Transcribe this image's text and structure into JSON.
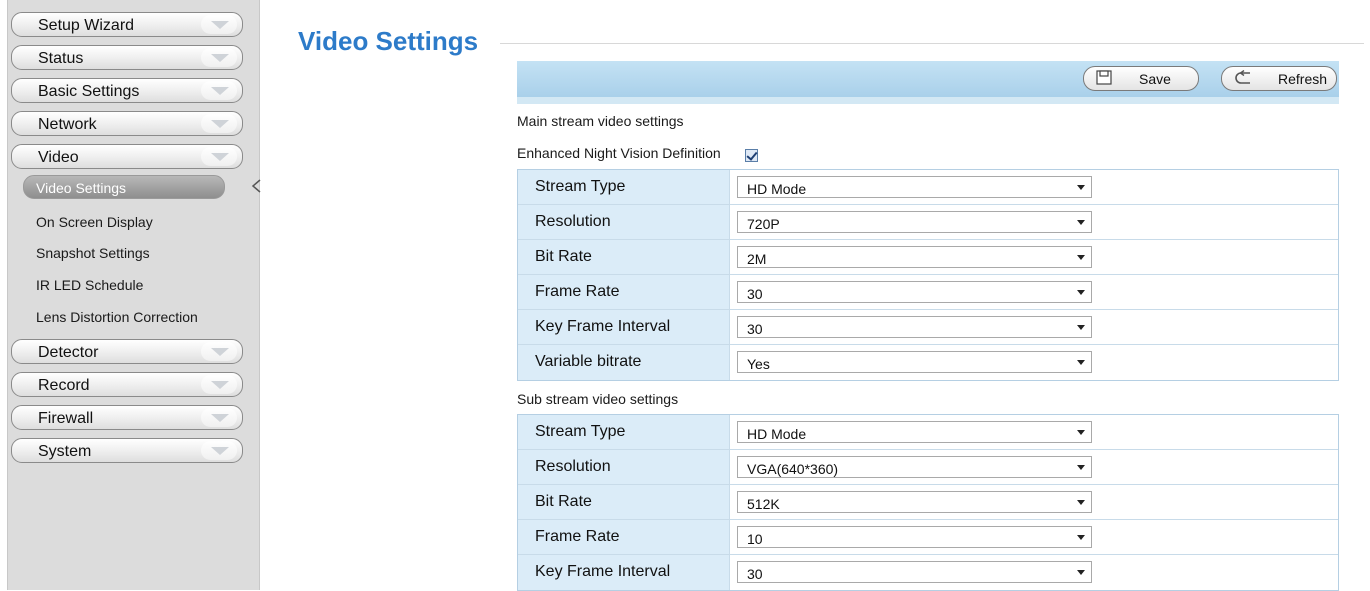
{
  "sidebar": {
    "menus_top": [
      "Setup Wizard",
      "Status",
      "Basic Settings",
      "Network",
      "Video"
    ],
    "video_subitems": [
      "Video Settings",
      "On Screen Display",
      "Snapshot Settings",
      "IR LED Schedule",
      "Lens Distortion Correction"
    ],
    "menus_bottom": [
      "Detector",
      "Record",
      "Firewall",
      "System"
    ]
  },
  "page": {
    "title": "Video Settings"
  },
  "toolbar": {
    "save_label": "Save",
    "refresh_label": "Refresh"
  },
  "main_stream": {
    "section_label": "Main stream video settings",
    "night_vision_label": "Enhanced Night Vision Definition",
    "night_vision_checked": true,
    "rows": [
      {
        "label": "Stream Type",
        "value": "HD Mode"
      },
      {
        "label": "Resolution",
        "value": "720P"
      },
      {
        "label": "Bit Rate",
        "value": "2M"
      },
      {
        "label": "Frame Rate",
        "value": "30"
      },
      {
        "label": "Key Frame Interval",
        "value": "30"
      },
      {
        "label": "Variable bitrate",
        "value": "Yes"
      }
    ]
  },
  "sub_stream": {
    "section_label": "Sub stream video settings",
    "rows": [
      {
        "label": "Stream Type",
        "value": "HD Mode"
      },
      {
        "label": "Resolution",
        "value": "VGA(640*360)"
      },
      {
        "label": "Bit Rate",
        "value": "512K"
      },
      {
        "label": "Frame Rate",
        "value": "10"
      },
      {
        "label": "Key Frame Interval",
        "value": "30"
      }
    ]
  }
}
